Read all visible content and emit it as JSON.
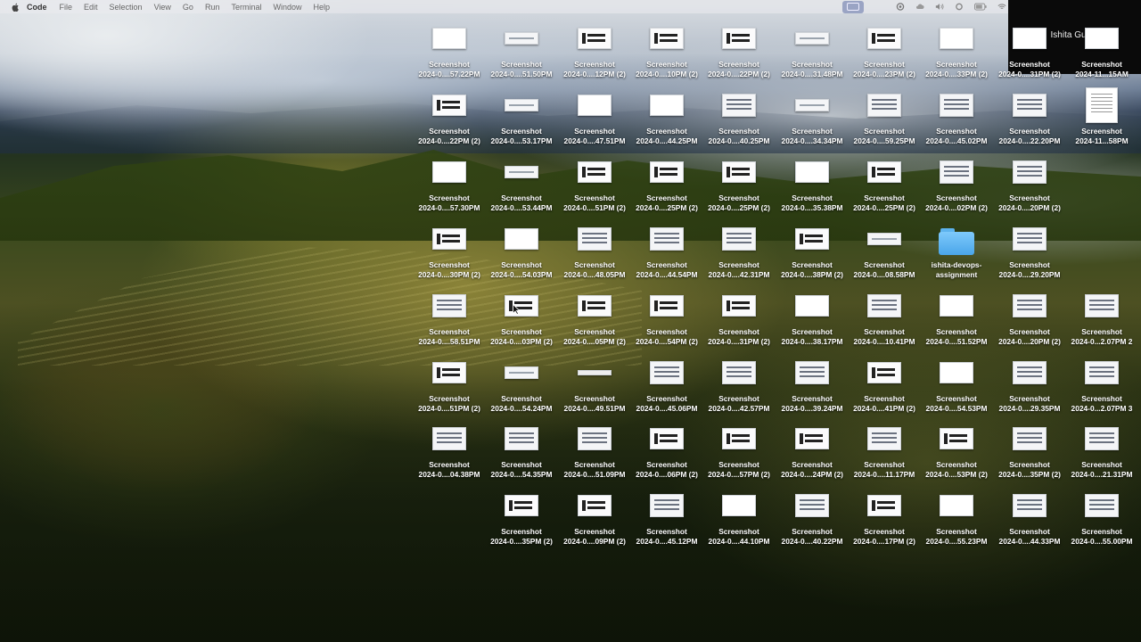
{
  "menubar": {
    "app_name": "Code",
    "menus": [
      "File",
      "Edit",
      "Selection",
      "View",
      "Go",
      "Run",
      "Terminal",
      "Window",
      "Help"
    ],
    "status_icons": [
      "screen-mirror-icon",
      "focus-icon",
      "cloud-icon",
      "volume-icon",
      "settings-icon",
      "battery-icon",
      "wifi-icon"
    ]
  },
  "zoom_panel": {
    "participant_name": "Ishita Gupta"
  },
  "desktop": {
    "rows": [
      [
        {
          "kind": "t5",
          "l1": "Screenshot",
          "l2": "2024-0....57.22PM"
        },
        {
          "kind": "t2",
          "l1": "Screenshot",
          "l2": "2024-0....51.50PM"
        },
        {
          "kind": "t3",
          "l1": "Screenshot",
          "l2": "2024-0....12PM (2)"
        },
        {
          "kind": "t3",
          "l1": "Screenshot",
          "l2": "2024-0....10PM (2)"
        },
        {
          "kind": "t3",
          "l1": "Screenshot",
          "l2": "2024-0....22PM (2)"
        },
        {
          "kind": "t2",
          "l1": "Screenshot",
          "l2": "2024-0....31.48PM"
        },
        {
          "kind": "t3",
          "l1": "Screenshot",
          "l2": "2024-0....23PM (2)"
        },
        {
          "kind": "t5",
          "l1": "Screenshot",
          "l2": "2024-0....33PM (2)"
        },
        {
          "kind": "t5",
          "l1": "Screenshot",
          "l2": "2024-0....31PM (2)"
        },
        {
          "kind": "t5",
          "l1": "Screenshot",
          "l2": "2024-11...15AM"
        }
      ],
      [
        {
          "kind": "t3",
          "l1": "Screenshot",
          "l2": "2024-0....22PM (2)"
        },
        {
          "kind": "t2",
          "l1": "Screenshot",
          "l2": "2024-0....53.17PM"
        },
        {
          "kind": "t5",
          "l1": "Screenshot",
          "l2": "2024-0....47.51PM"
        },
        {
          "kind": "t5",
          "l1": "Screenshot",
          "l2": "2024-0....44.25PM"
        },
        {
          "kind": "t1",
          "l1": "Screenshot",
          "l2": "2024-0....40.25PM"
        },
        {
          "kind": "t2",
          "l1": "Screenshot",
          "l2": "2024-0....34.34PM"
        },
        {
          "kind": "t1",
          "l1": "Screenshot",
          "l2": "2024-0....59.25PM"
        },
        {
          "kind": "t1",
          "l1": "Screenshot",
          "l2": "2024-0....45.02PM"
        },
        {
          "kind": "t1",
          "l1": "Screenshot",
          "l2": "2024-0....22.20PM"
        },
        {
          "kind": "doc",
          "l1": "Screenshot",
          "l2": "2024-11...58PM"
        }
      ],
      [
        {
          "kind": "t5",
          "l1": "Screenshot",
          "l2": "2024-0....57.30PM"
        },
        {
          "kind": "t2",
          "l1": "Screenshot",
          "l2": "2024-0....53.44PM"
        },
        {
          "kind": "t3",
          "l1": "Screenshot",
          "l2": "2024-0....51PM (2)"
        },
        {
          "kind": "t3",
          "l1": "Screenshot",
          "l2": "2024-0....25PM (2)"
        },
        {
          "kind": "t3",
          "l1": "Screenshot",
          "l2": "2024-0....25PM (2)"
        },
        {
          "kind": "t5",
          "l1": "Screenshot",
          "l2": "2024-0....35.38PM"
        },
        {
          "kind": "t3",
          "l1": "Screenshot",
          "l2": "2024-0....25PM (2)"
        },
        {
          "kind": "t1",
          "l1": "Screenshot",
          "l2": "2024-0....02PM (2)"
        },
        {
          "kind": "t1",
          "l1": "Screenshot",
          "l2": "2024-0....20PM (2)"
        },
        null
      ],
      [
        {
          "kind": "t3",
          "l1": "Screenshot",
          "l2": "2024-0....30PM (2)"
        },
        {
          "kind": "t5",
          "l1": "Screenshot",
          "l2": "2024-0....54.03PM"
        },
        {
          "kind": "t1",
          "l1": "Screenshot",
          "l2": "2024-0....48.05PM"
        },
        {
          "kind": "t1",
          "l1": "Screenshot",
          "l2": "2024-0....44.54PM"
        },
        {
          "kind": "t1",
          "l1": "Screenshot",
          "l2": "2024-0....42.31PM"
        },
        {
          "kind": "t3",
          "l1": "Screenshot",
          "l2": "2024-0....38PM (2)"
        },
        {
          "kind": "t2",
          "l1": "Screenshot",
          "l2": "2024-0....08.58PM"
        },
        {
          "kind": "folder",
          "l1": "ishita-devops-",
          "l2": "assignment"
        },
        {
          "kind": "t1",
          "l1": "Screenshot",
          "l2": "2024-0....29.20PM"
        },
        null
      ],
      [
        {
          "kind": "t1",
          "l1": "Screenshot",
          "l2": "2024-0....58.51PM"
        },
        {
          "kind": "t3",
          "l1": "Screenshot",
          "l2": "2024-0....03PM (2)"
        },
        {
          "kind": "t3",
          "l1": "Screenshot",
          "l2": "2024-0....05PM (2)"
        },
        {
          "kind": "t3",
          "l1": "Screenshot",
          "l2": "2024-0....54PM (2)"
        },
        {
          "kind": "t3",
          "l1": "Screenshot",
          "l2": "2024-0....31PM (2)"
        },
        {
          "kind": "t5",
          "l1": "Screenshot",
          "l2": "2024-0....38.17PM"
        },
        {
          "kind": "t1",
          "l1": "Screenshot",
          "l2": "2024-0....10.41PM"
        },
        {
          "kind": "t5",
          "l1": "Screenshot",
          "l2": "2024-0....51.52PM"
        },
        {
          "kind": "t1",
          "l1": "Screenshot",
          "l2": "2024-0....20PM (2)"
        },
        {
          "kind": "t1",
          "l1": "Screenshot",
          "l2": "2024-0...2.07PM 2"
        }
      ],
      [
        {
          "kind": "t3",
          "l1": "Screenshot",
          "l2": "2024-0....51PM (2)"
        },
        {
          "kind": "t2",
          "l1": "Screenshot",
          "l2": "2024-0....54.24PM"
        },
        {
          "kind": "t4",
          "l1": "Screenshot",
          "l2": "2024-0....49.51PM"
        },
        {
          "kind": "t1",
          "l1": "Screenshot",
          "l2": "2024-0....45.06PM"
        },
        {
          "kind": "t1",
          "l1": "Screenshot",
          "l2": "2024-0....42.57PM"
        },
        {
          "kind": "t1",
          "l1": "Screenshot",
          "l2": "2024-0....39.24PM"
        },
        {
          "kind": "t3",
          "l1": "Screenshot",
          "l2": "2024-0....41PM (2)"
        },
        {
          "kind": "t5",
          "l1": "Screenshot",
          "l2": "2024-0....54.53PM"
        },
        {
          "kind": "t1",
          "l1": "Screenshot",
          "l2": "2024-0....29.35PM"
        },
        {
          "kind": "t1",
          "l1": "Screenshot",
          "l2": "2024-0...2.07PM 3"
        }
      ],
      [
        {
          "kind": "t1",
          "l1": "Screenshot",
          "l2": "2024-0....04.38PM"
        },
        {
          "kind": "t1",
          "l1": "Screenshot",
          "l2": "2024-0....54.35PM"
        },
        {
          "kind": "t1",
          "l1": "Screenshot",
          "l2": "2024-0....51.09PM"
        },
        {
          "kind": "t3",
          "l1": "Screenshot",
          "l2": "2024-0....06PM (2)"
        },
        {
          "kind": "t3",
          "l1": "Screenshot",
          "l2": "2024-0....57PM (2)"
        },
        {
          "kind": "t3",
          "l1": "Screenshot",
          "l2": "2024-0....24PM (2)"
        },
        {
          "kind": "t1",
          "l1": "Screenshot",
          "l2": "2024-0....11.17PM"
        },
        {
          "kind": "t3",
          "l1": "Screenshot",
          "l2": "2024-0....53PM (2)"
        },
        {
          "kind": "t1",
          "l1": "Screenshot",
          "l2": "2024-0....35PM (2)"
        },
        {
          "kind": "t1",
          "l1": "Screenshot",
          "l2": "2024-0....21.31PM"
        }
      ],
      [
        null,
        {
          "kind": "t3",
          "l1": "Screenshot",
          "l2": "2024-0....35PM (2)"
        },
        {
          "kind": "t3",
          "l1": "Screenshot",
          "l2": "2024-0....09PM (2)"
        },
        {
          "kind": "t1",
          "l1": "Screenshot",
          "l2": "2024-0....45.12PM"
        },
        {
          "kind": "t5",
          "l1": "Screenshot",
          "l2": "2024-0....44.10PM"
        },
        {
          "kind": "t1",
          "l1": "Screenshot",
          "l2": "2024-0....40.22PM"
        },
        {
          "kind": "t3",
          "l1": "Screenshot",
          "l2": "2024-0....17PM (2)"
        },
        {
          "kind": "t5",
          "l1": "Screenshot",
          "l2": "2024-0....55.23PM"
        },
        {
          "kind": "t1",
          "l1": "Screenshot",
          "l2": "2024-0....44.33PM"
        },
        {
          "kind": "t1",
          "l1": "Screenshot",
          "l2": "2024-0....55.00PM"
        }
      ]
    ]
  }
}
